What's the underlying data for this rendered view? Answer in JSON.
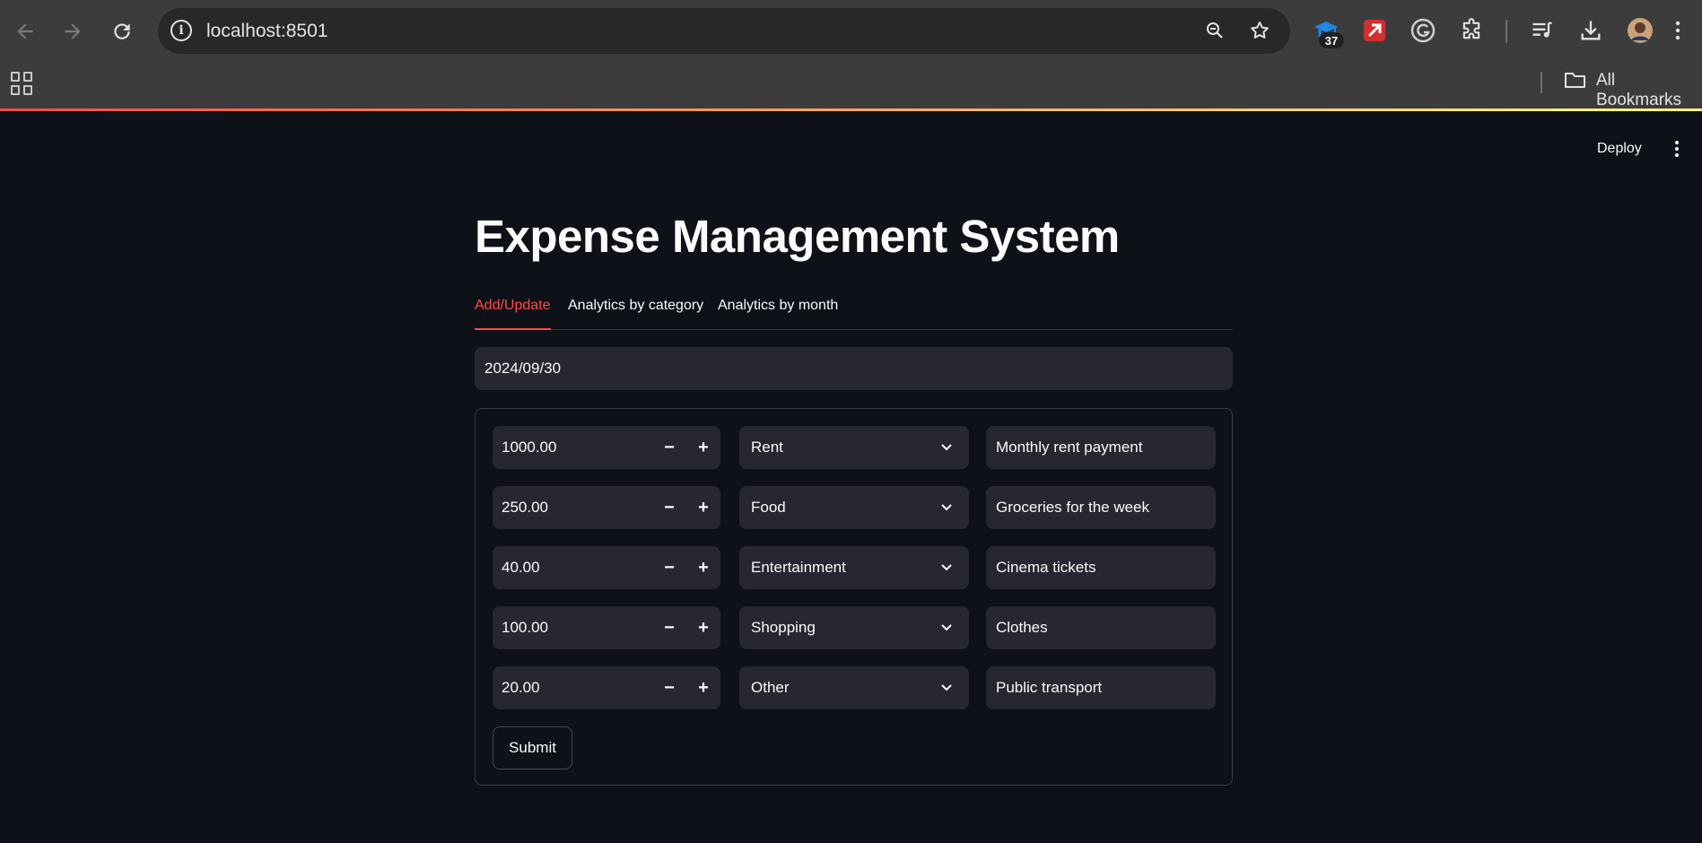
{
  "browser": {
    "url": "localhost:8501",
    "extension_badge": "37",
    "bookmarks_label": "All Bookmarks",
    "accent_gradient": [
      "#ff4b4b",
      "#fffd80"
    ]
  },
  "header": {
    "deploy_label": "Deploy"
  },
  "app": {
    "title": "Expense Management System",
    "tabs": [
      {
        "label": "Add/Update",
        "active": true
      },
      {
        "label": "Analytics by category",
        "active": false
      },
      {
        "label": "Analytics by month",
        "active": false
      }
    ],
    "date_value": "2024/09/30",
    "rows": [
      {
        "amount": "1000.00",
        "category": "Rent",
        "notes": "Monthly rent payment"
      },
      {
        "amount": "250.00",
        "category": "Food",
        "notes": "Groceries for the week"
      },
      {
        "amount": "40.00",
        "category": "Entertainment",
        "notes": "Cinema tickets"
      },
      {
        "amount": "100.00",
        "category": "Shopping",
        "notes": "Clothes"
      },
      {
        "amount": "20.00",
        "category": "Other",
        "notes": "Public transport"
      }
    ],
    "submit_label": "Submit",
    "accent_color": "#ff4b4b"
  }
}
